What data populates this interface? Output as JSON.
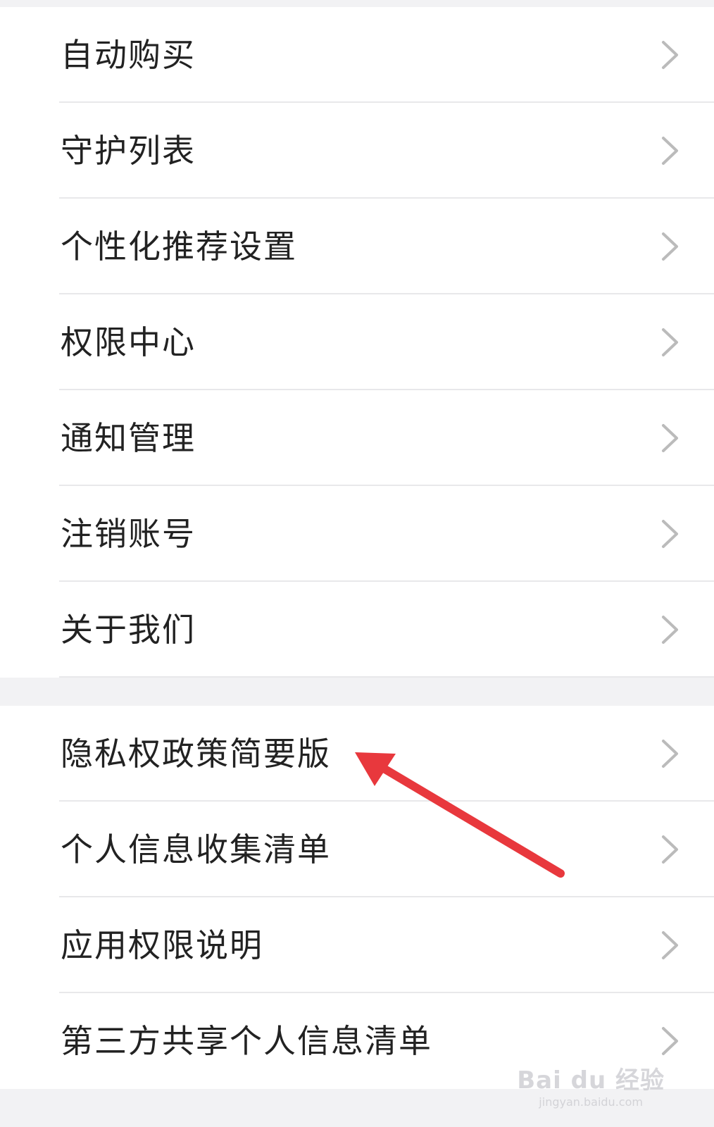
{
  "group1": {
    "items": [
      {
        "label": "自动购买"
      },
      {
        "label": "守护列表"
      },
      {
        "label": "个性化推荐设置"
      },
      {
        "label": "权限中心"
      },
      {
        "label": "通知管理"
      },
      {
        "label": "注销账号"
      },
      {
        "label": "关于我们"
      }
    ]
  },
  "group2": {
    "items": [
      {
        "label": "隐私权政策简要版"
      },
      {
        "label": "个人信息收集清单"
      },
      {
        "label": "应用权限说明"
      },
      {
        "label": "第三方共享个人信息清单"
      }
    ]
  },
  "icons": {
    "row_chevron": "chevron-right-icon",
    "annotation": "red-arrow-icon"
  },
  "colors": {
    "background": "#f2f2f4",
    "row_bg": "#ffffff",
    "text": "#222222",
    "chevron": "#bbbbbb",
    "annotation_arrow": "#e8383d"
  },
  "watermark": {
    "logo": "Bai du 经验",
    "url": "jingyan.baidu.com"
  }
}
